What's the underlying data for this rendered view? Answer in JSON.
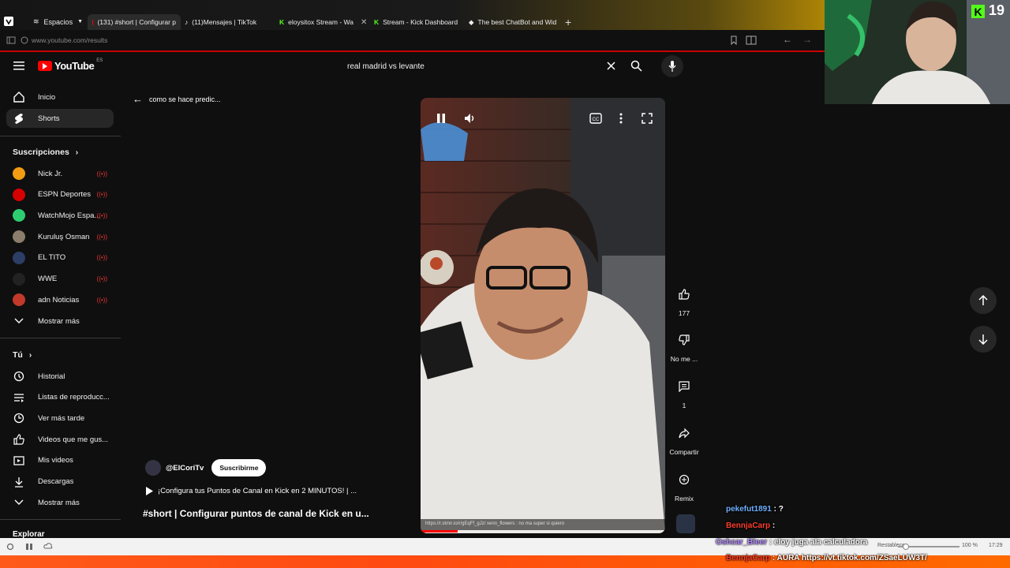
{
  "browser": {
    "spaces_label": "Espacios",
    "tabs": [
      {
        "title": "(131) #short | Configurar p",
        "active": true,
        "icon": "youtube-icon"
      },
      {
        "title": "(11)Mensajes | TikTok",
        "active": false,
        "icon": "tiktok-icon"
      },
      {
        "title": "eloysitox Stream - Wa",
        "active": false,
        "icon": "kick-icon"
      },
      {
        "title": "Stream - Kick Dashboard",
        "active": false,
        "icon": "kick-icon"
      },
      {
        "title": "The best ChatBot and Wid",
        "active": false,
        "icon": "chatbot-icon"
      }
    ],
    "url": "www.youtube.com/results"
  },
  "youtube": {
    "logo_text": "YouTube",
    "country": "ES",
    "search_value": "real madrid vs levante",
    "back_label": "como se hace predic..."
  },
  "sidebar": {
    "main": [
      {
        "label": "Inicio",
        "icon": "home-icon"
      },
      {
        "label": "Shorts",
        "icon": "shorts-icon",
        "selected": true
      }
    ],
    "subs_title": "Suscripciones",
    "subs": [
      {
        "label": "Nick Jr.",
        "color": "#f39c12"
      },
      {
        "label": "ESPN Deportes",
        "color": "#d50000"
      },
      {
        "label": "WatchMojo Espa...",
        "color": "#2ecc71"
      },
      {
        "label": "Kuruluş Osman",
        "color": "#8a7d6b"
      },
      {
        "label": "EL TITO",
        "color": "#2c3e66"
      },
      {
        "label": "WWE",
        "color": "#222222"
      },
      {
        "label": "adn Noticias",
        "color": "#c0392b"
      }
    ],
    "subs_more": "Mostrar más",
    "you_title": "Tú",
    "you": [
      {
        "label": "Historial",
        "icon": "history-icon"
      },
      {
        "label": "Listas de reproducc...",
        "icon": "playlist-icon"
      },
      {
        "label": "Ver más tarde",
        "icon": "clock-icon"
      },
      {
        "label": "Videos que me gus...",
        "icon": "like-icon"
      },
      {
        "label": "Mis videos",
        "icon": "video-icon"
      },
      {
        "label": "Descargas",
        "icon": "download-icon"
      }
    ],
    "you_more": "Mostrar más",
    "explore": "Explorar"
  },
  "short": {
    "channel": "@ElCoriTv",
    "subscribe": "Suscribirme",
    "related": "¡Configura tus Puntos de Canal en Kick en 2 MINUTOS! | ...",
    "title": "#short | Configurar puntos de canal de Kick en u...",
    "overlay": "https://r.stmn.io/r/gEqFf_gJz/  xenn_flowers : no ma super si quiero",
    "progress": 0.15
  },
  "actions": {
    "like_count": "177",
    "dislike_label": "No me ...",
    "comments_count": "1",
    "share_label": "Compartir",
    "remix_label": "Remix"
  },
  "kick_overlay": {
    "viewer_count": "19"
  },
  "chat": [
    {
      "user": "pekefut1891",
      "text": " : ?",
      "color": "#6fb0ff"
    },
    {
      "user": "BennjaCarp",
      "text": " : ",
      "color": "#ff3d2e"
    },
    {
      "user": "Oshcar_Bleer",
      "text": " : eloy juga ala calculadora",
      "color": "#b58cff"
    },
    {
      "user": "BennjaCarp",
      "text": " : AURA https://vt.tiktok.com/ZSaeLUW3T/",
      "color": "#ff3d2e"
    }
  ],
  "statusbar": {
    "zoom": "100 %",
    "time": "17:29",
    "restore": "Restablecer"
  }
}
